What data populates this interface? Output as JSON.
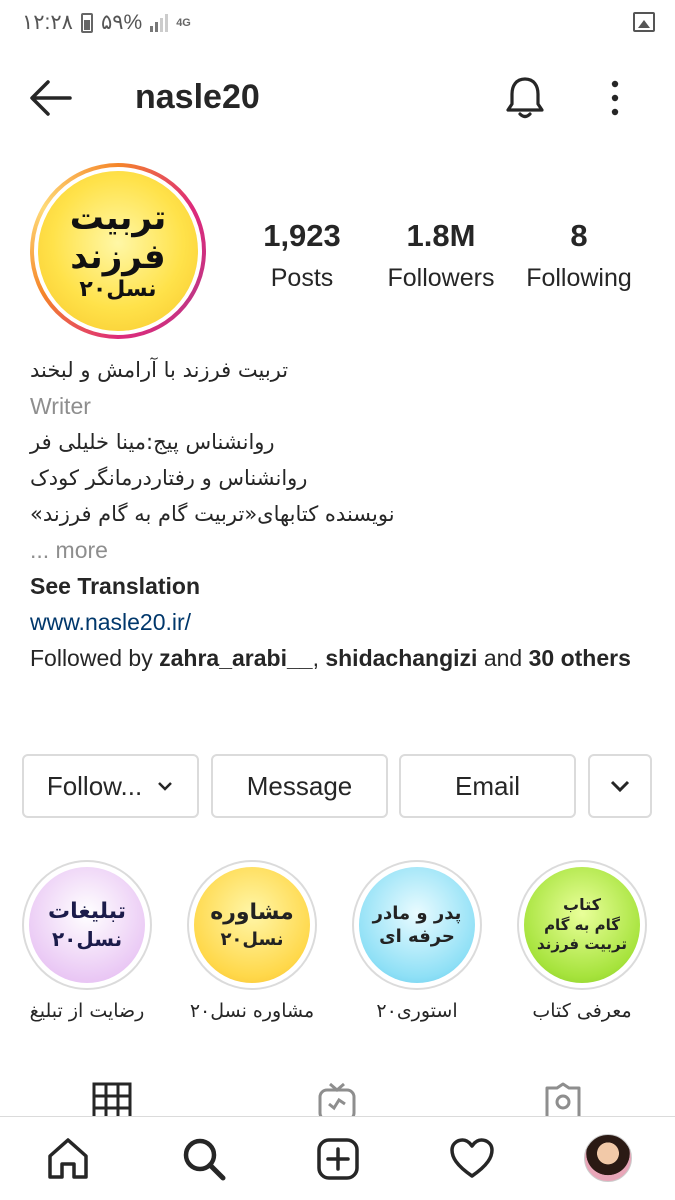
{
  "status_bar": {
    "time": "۱۲:۲۸",
    "battery": "۵۹%",
    "network": "4G"
  },
  "header": {
    "username": "nasle20"
  },
  "profile": {
    "avatar_text": [
      "تربیت",
      "فرزند",
      "نسل۲۰"
    ],
    "stats": [
      {
        "value": "1,923",
        "label": "Posts"
      },
      {
        "value": "1.8M",
        "label": "Followers"
      },
      {
        "value": "8",
        "label": "Following"
      }
    ]
  },
  "bio": {
    "line1": "تربیت فرزند با آرامش و لبخند",
    "category": "Writer",
    "line2": "روانشناس پیج:مینا خلیلی فر",
    "line3": "روانشناس و رفتاردرمانگر کودک",
    "line4": "نویسنده کتابهای«تربیت گام به گام فرزند»",
    "more": "... more",
    "see_translation": "See Translation",
    "website": "www.nasle20.ir/",
    "followed_by_prefix": "Followed by ",
    "followed_user1": "zahra_arabi__",
    "followed_sep": ", ",
    "followed_user2": "shidachangizi",
    "followed_and": " and ",
    "followed_count": "30 others"
  },
  "buttons": {
    "follow": "Follow...",
    "message": "Message",
    "email": "Email"
  },
  "highlights": [
    {
      "label": "رضایت از تبلیغ",
      "lines": [
        "تبلیغات",
        "نسل۲۰"
      ],
      "color": "#e9c6f4"
    },
    {
      "label": "مشاوره نسل۲۰",
      "lines": [
        "مشاوره",
        "نسل۲۰"
      ],
      "color": "#ffd84a"
    },
    {
      "label": "استوری۲۰",
      "lines": [
        "پدر و مادر",
        "حرفه ای"
      ],
      "color": "#8fe0f6"
    },
    {
      "label": "معرفی کتاب",
      "lines": [
        "کتاب",
        "گام به گام",
        "تربیت فرزند"
      ],
      "color": "#a6e33c"
    }
  ]
}
